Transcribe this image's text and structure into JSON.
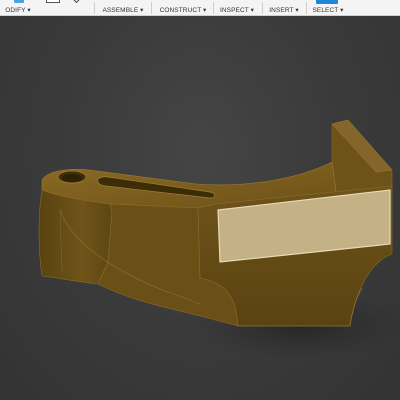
{
  "toolbar": {
    "groups": [
      {
        "label": "ODIFY ▾"
      },
      {
        "label": "ASSEMBLE ▾"
      },
      {
        "label": "CONSTRUCT ▾"
      },
      {
        "label": "INSPECT ▾"
      },
      {
        "label": "INSERT ▾"
      },
      {
        "label": "SELECT ▾"
      }
    ]
  },
  "icons": {
    "modify": "modify-icon",
    "assemble": "assemble-icon",
    "select": "select-icon"
  },
  "colors": {
    "model_top": "#7a5c1c",
    "model_side": "#5e4612",
    "model_front": "#6b5018",
    "selected_face": "#c7b487",
    "viewport_bg": "#3a3a3a"
  }
}
